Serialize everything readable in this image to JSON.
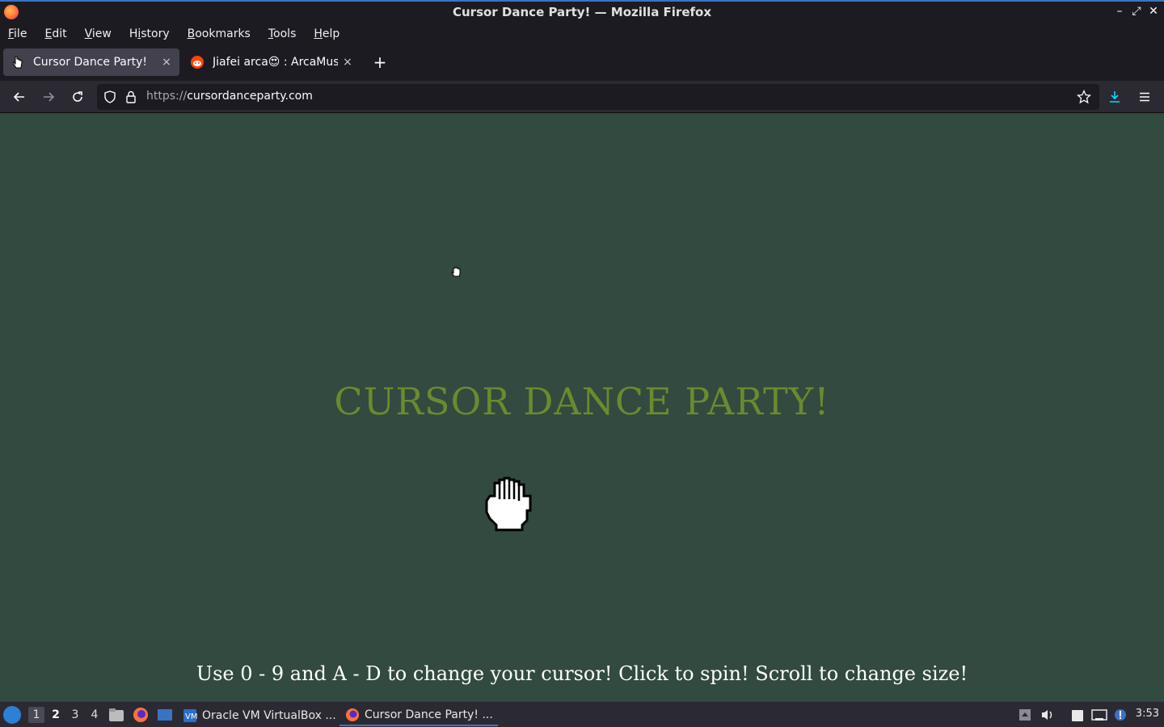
{
  "window": {
    "title": "Cursor Dance Party! — Mozilla Firefox",
    "controls": {
      "minimize": "–",
      "maximize": "⤢",
      "close": "✕"
    }
  },
  "menu": {
    "items": [
      {
        "first": "F",
        "rest": "ile"
      },
      {
        "first": "E",
        "rest": "dit"
      },
      {
        "first": "V",
        "rest": "iew"
      },
      {
        "first": "H",
        "rest": "istory",
        "pre": ""
      },
      {
        "first": "B",
        "rest": "ookmarks"
      },
      {
        "first": "T",
        "rest": "ools"
      },
      {
        "first": "H",
        "rest": "elp"
      }
    ]
  },
  "tabs": [
    {
      "label": "Cursor Dance Party!",
      "icon": "hand-cursor-icon",
      "active": true,
      "close": "×"
    },
    {
      "label": "Jiafei arca😍 : ArcaMusic",
      "icon": "reddit-icon",
      "active": false,
      "close": "×"
    }
  ],
  "newtab_label": "+",
  "urlbar": {
    "scheme": "https://",
    "host": "cursordanceparty.com"
  },
  "page": {
    "heading": "CURSOR DANCE PARTY!",
    "instructions": "Use 0 - 9 and A - D to change your cursor! Click to spin! Scroll to change size!",
    "background": "#324a3f",
    "heading_color": "#6b8a2e"
  },
  "taskbar": {
    "workspaces": [
      "1",
      "2",
      "3",
      "4"
    ],
    "tasks": [
      {
        "label": "Oracle VM VirtualBox ...",
        "icon": "virtualbox-icon"
      },
      {
        "label": "Cursor Dance Party! ...",
        "icon": "firefox-icon"
      }
    ],
    "clock": "3:53"
  }
}
